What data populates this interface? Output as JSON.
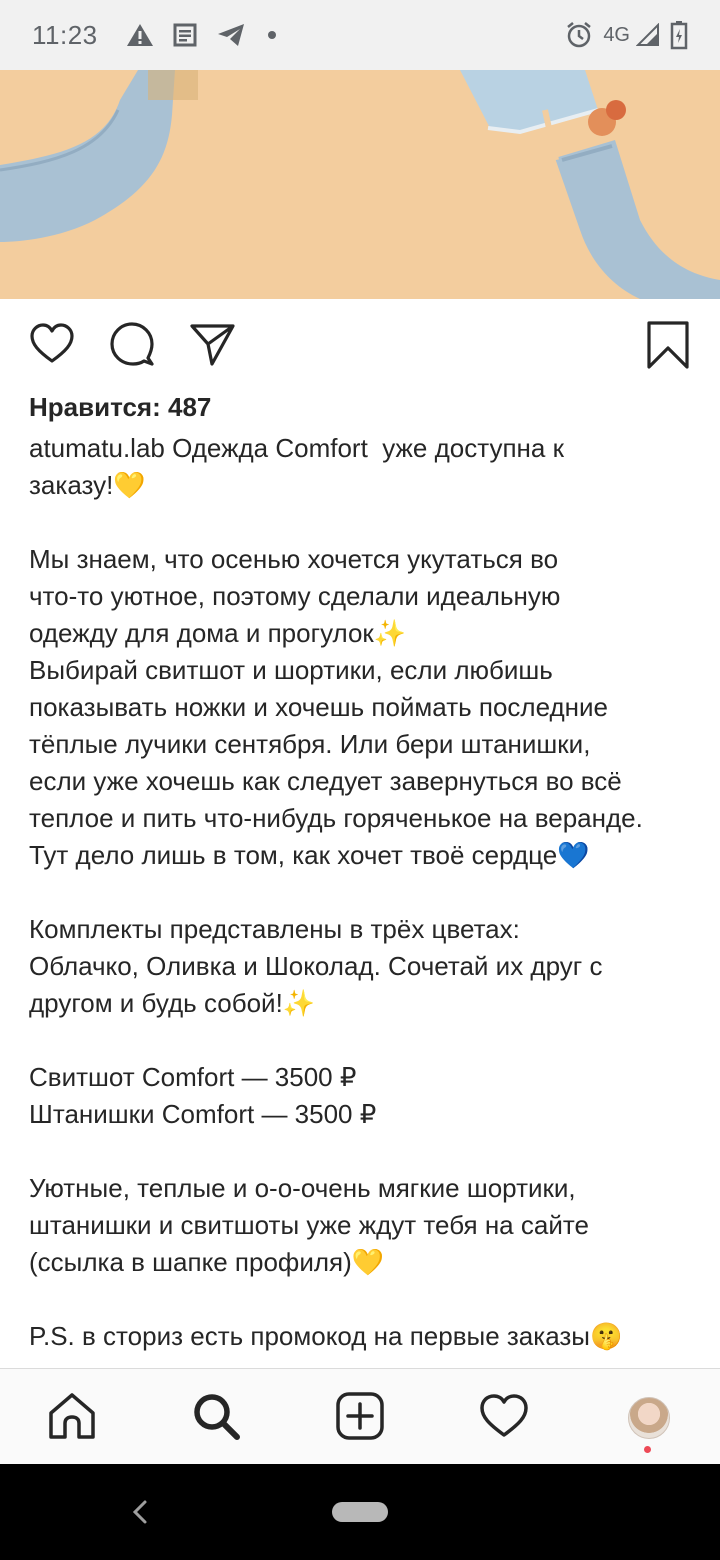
{
  "status_bar": {
    "time": "11:23",
    "network": "4G"
  },
  "post": {
    "likes": "Нравится: 487",
    "username": "atumatu.lab",
    "caption": " Одежда Comfort  уже доступна к\nзаказу!💛\n\nМы знаем, что осенью хочется укутаться во\nчто-то уютное, поэтому сделали идеальную\nодежду для дома и прогулок✨\nВыбирай свитшот и шортики, если любишь\nпоказывать ножки и хочешь поймать последние\nтёплые лучики сентября. Или бери штанишки,\nесли уже хочешь как следует завернуться во всё\nтеплое и пить что-нибудь горяченькое на веранде.\nТут дело лишь в том, как хочет твоё сердце💙\n\nКомплекты представлены в трёх цветах:\nОблачко, Оливка и Шоколад. Сочетай их друг с\nдругом и будь собой!✨\n\nСвитшот Comfort — 3500 ₽\nШтанишки Comfort — 3500 ₽\n\nУютные, теплые и о-о-очень мягкие шортики,\nштанишки и свитшоты уже ждут тебя на сайте\n(ссылка в шапке профиля)💛\n\nP.S. в сториз есть промокод на первые заказы🤫"
  },
  "icons": {
    "status": [
      "warning-icon",
      "news-icon",
      "telegram-icon",
      "alarm-icon",
      "signal-icon",
      "battery-icon"
    ],
    "actions": [
      "like-icon",
      "comment-icon",
      "share-icon",
      "bookmark-icon"
    ],
    "nav": [
      "home-icon",
      "search-icon",
      "new-post-icon",
      "activity-icon",
      "profile-avatar"
    ]
  },
  "colors": {
    "text": "#262626",
    "status_bar_bg": "#f1f1f1",
    "nav_bar_bg": "#fafafa",
    "notification_dot": "#ed4956",
    "photo_background": "#f2cc9c",
    "sock_blue": "#a9c1d3"
  }
}
